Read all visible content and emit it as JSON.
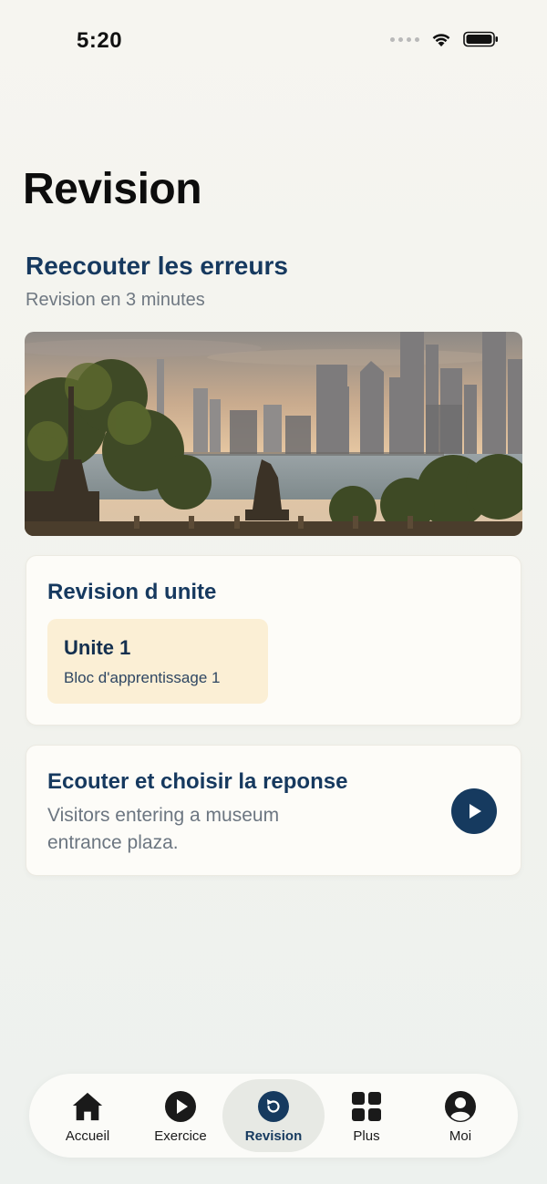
{
  "status_bar": {
    "time": "5:20"
  },
  "page": {
    "title": "Revision"
  },
  "errors_section": {
    "title": "Reecouter les erreurs",
    "subtitle": "Revision en 3 minutes"
  },
  "unit_review": {
    "title": "Revision d unite",
    "unit_title": "Unite 1",
    "unit_subtitle": "Bloc d'apprentissage 1"
  },
  "listen_card": {
    "title": "Ecouter et choisir la reponse",
    "description": "Visitors entering a museum entrance plaza.",
    "play_icon": "play-icon"
  },
  "tab_bar": {
    "items": [
      {
        "label": "Accueil",
        "icon": "home-icon"
      },
      {
        "label": "Exercice",
        "icon": "play-circle-icon"
      },
      {
        "label": "Revision",
        "icon": "review-icon",
        "active": true
      },
      {
        "label": "Plus",
        "icon": "grid-icon"
      },
      {
        "label": "Moi",
        "icon": "profile-icon"
      }
    ]
  },
  "colors": {
    "accent": "#163a5f",
    "chip_background": "#fbefd5",
    "card_background": "#fdfcf8",
    "page_background": "#f3f3ee"
  }
}
